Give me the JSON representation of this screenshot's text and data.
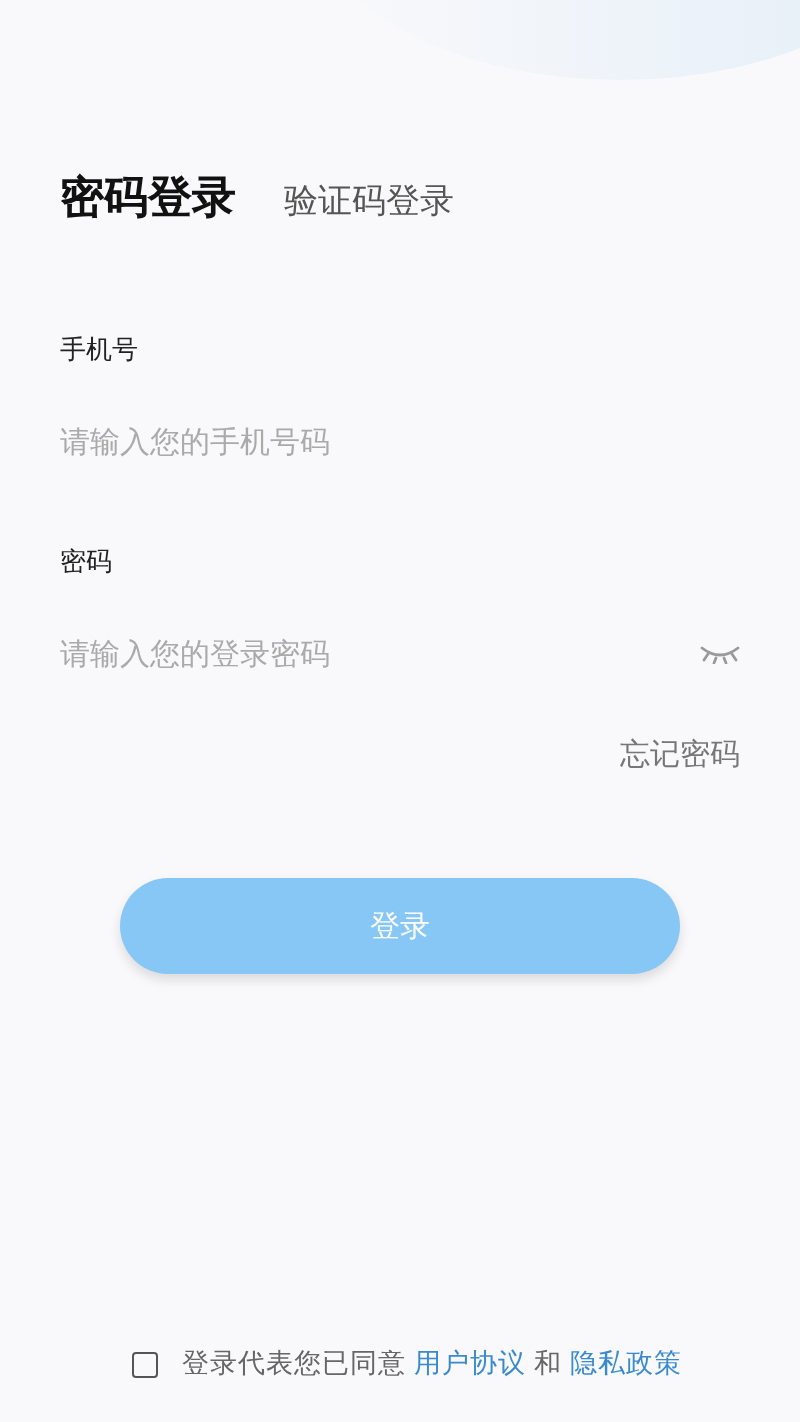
{
  "tabs": [
    {
      "label": "密码登录",
      "selected": true
    },
    {
      "label": "验证码登录",
      "selected": false
    }
  ],
  "fields": [
    {
      "label": "手机号",
      "placeholder": "请输入您的手机号码",
      "kind": "text"
    },
    {
      "label": "密码",
      "placeholder": "请输入您的登录密码",
      "kind": "password"
    }
  ],
  "forgot_link": "忘记密码",
  "login_button": {
    "label": "登录",
    "disabled": true
  },
  "agreement": {
    "checked": false,
    "text": "登录代表您已同意",
    "link_1": "用户协议",
    "joiner": "和",
    "link_2": "隐私政策"
  }
}
